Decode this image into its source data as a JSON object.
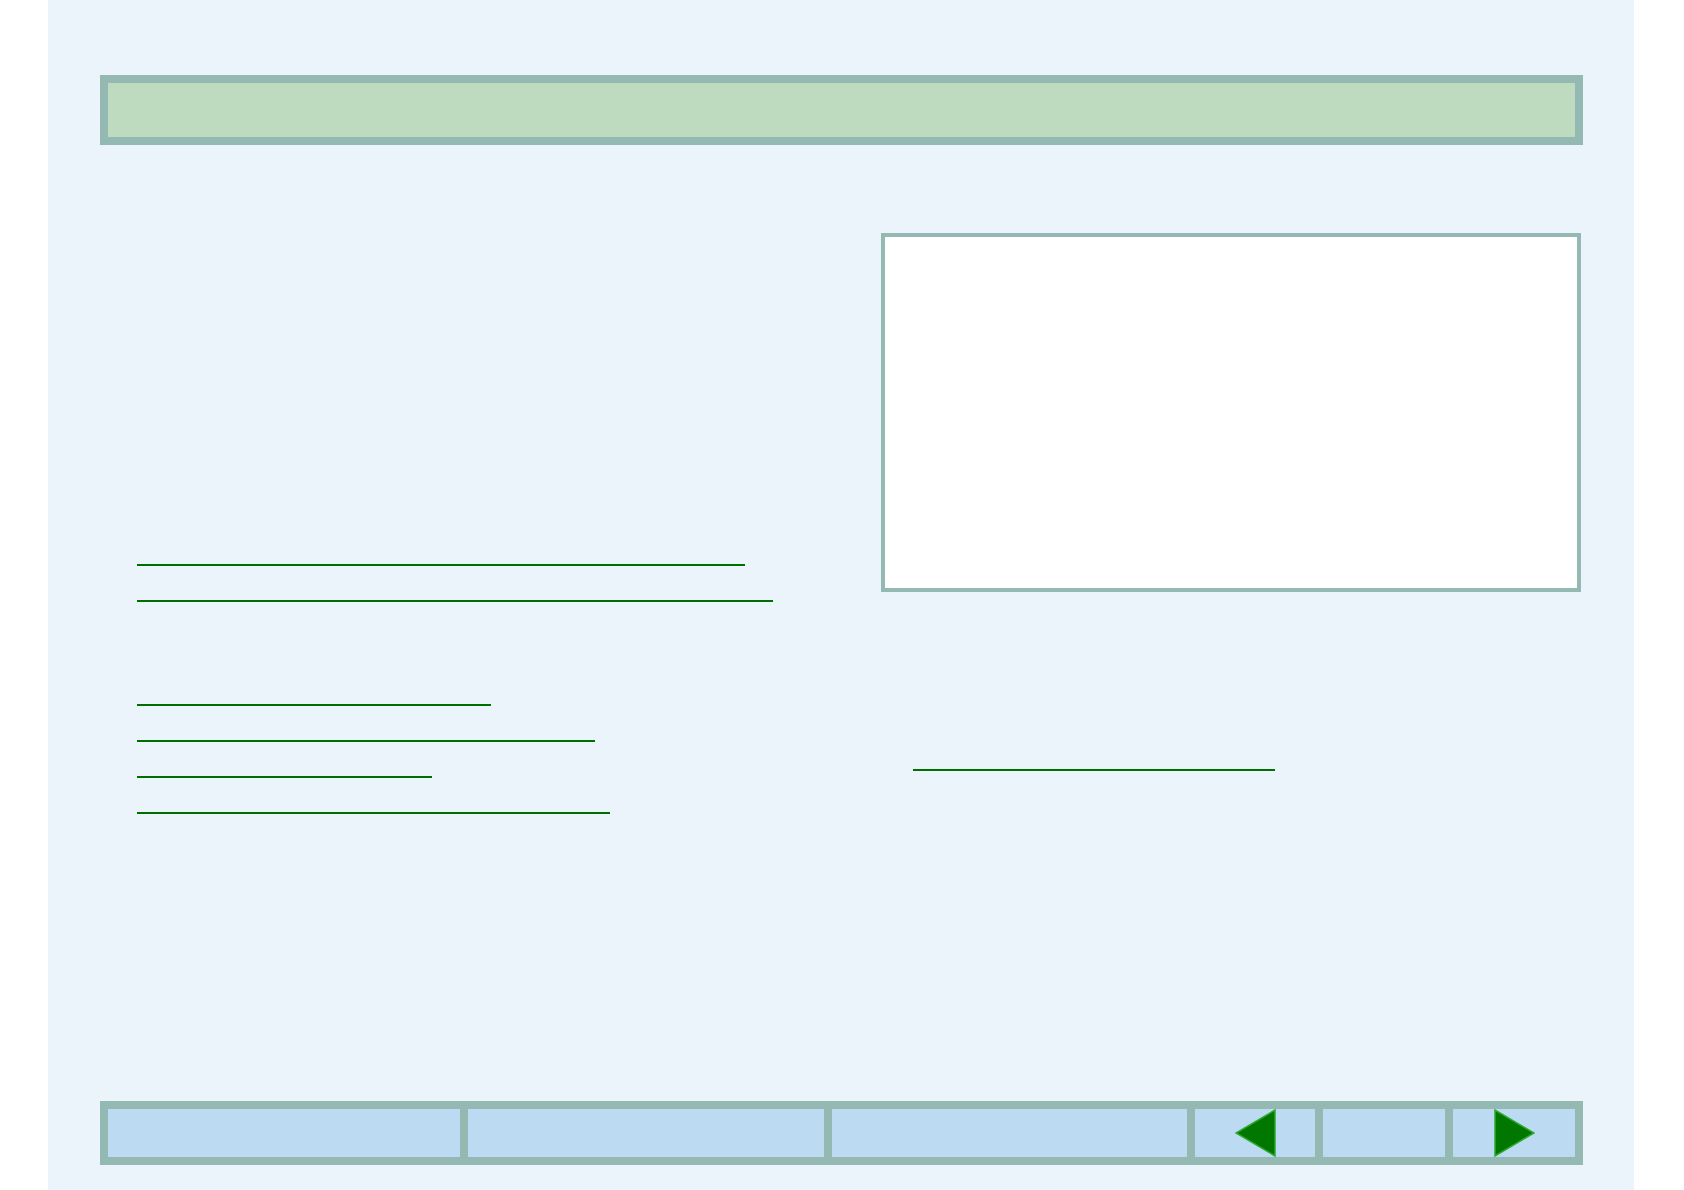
{
  "link_groups": [
    {
      "links": [
        {
          "kind": "underline"
        },
        {
          "kind": "underline"
        }
      ]
    },
    {
      "links": [
        {
          "kind": "underline"
        },
        {
          "kind": "underline"
        },
        {
          "kind": "underline"
        },
        {
          "kind": "underline"
        }
      ]
    }
  ],
  "figure_links": [
    {
      "kind": "underline"
    }
  ],
  "nav_bar": {
    "cells": [
      {
        "kind": "blank"
      },
      {
        "kind": "blank"
      },
      {
        "kind": "blank"
      },
      {
        "kind": "previous"
      },
      {
        "kind": "blank"
      },
      {
        "kind": "next"
      }
    ]
  }
}
